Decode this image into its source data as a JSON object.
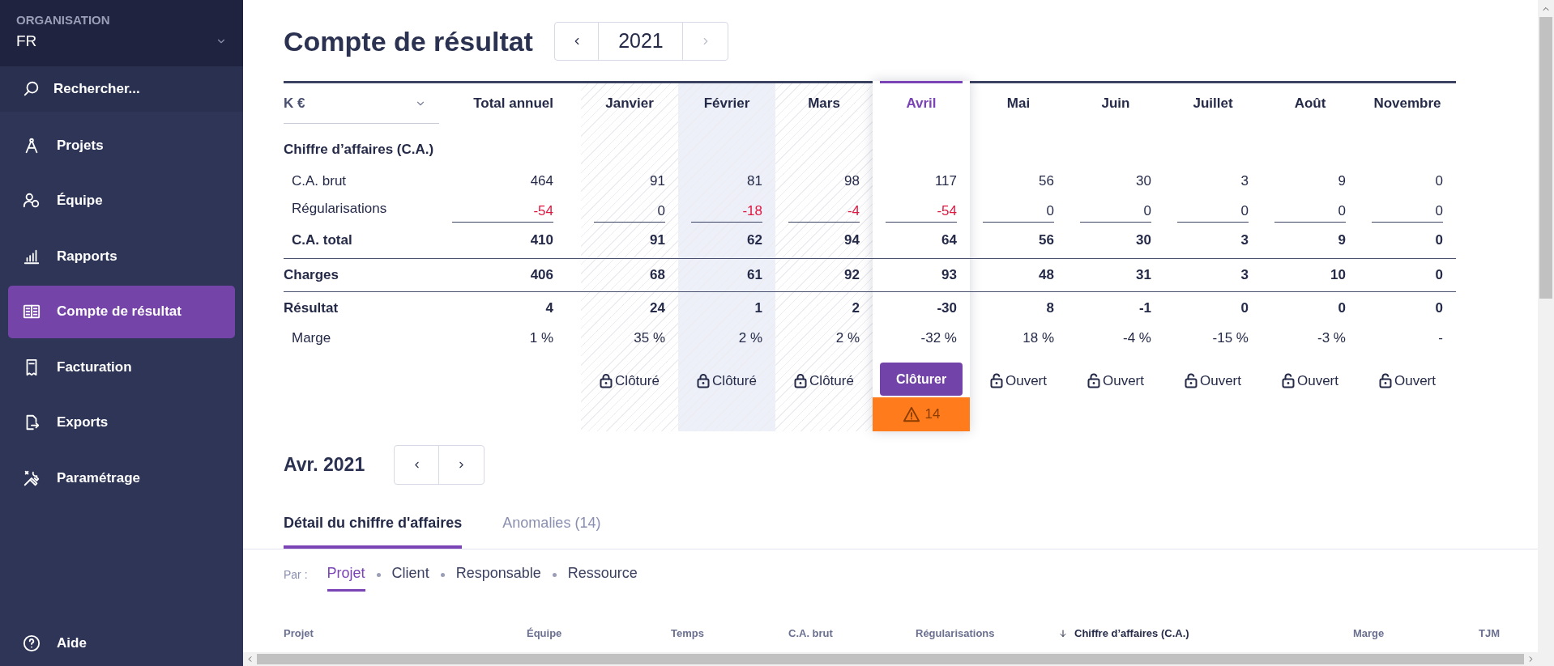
{
  "sidebar": {
    "organisation_label": "ORGANISATION",
    "organisation": "FR",
    "search": "Rechercher...",
    "items": [
      {
        "label": "Projets",
        "selected": false
      },
      {
        "label": "Équipe",
        "selected": false
      },
      {
        "label": "Rapports",
        "selected": false
      },
      {
        "label": "Compte de résultat",
        "selected": true
      },
      {
        "label": "Facturation",
        "selected": false
      },
      {
        "label": "Exports",
        "selected": false
      },
      {
        "label": "Paramétrage",
        "selected": false
      }
    ],
    "help": "Aide"
  },
  "header": {
    "title": "Compte de résultat",
    "year": "2021",
    "next_disabled": true
  },
  "table": {
    "unit": "K €",
    "total_label": "Total annuel",
    "months": [
      {
        "label": "Janvier",
        "kind": "closed",
        "status_label": "Clôturé",
        "highlighted": false
      },
      {
        "label": "Février",
        "kind": "closed",
        "status_label": "Clôturé",
        "highlighted": true
      },
      {
        "label": "Mars",
        "kind": "closed",
        "status_label": "Clôturé",
        "highlighted": false
      },
      {
        "label": "Avril",
        "kind": "current",
        "status_label": "Clôturer",
        "warning": "14",
        "highlighted": false
      },
      {
        "label": "Mai",
        "kind": "open",
        "status_label": "Ouvert",
        "highlighted": false
      },
      {
        "label": "Juin",
        "kind": "open",
        "status_label": "Ouvert",
        "highlighted": false
      },
      {
        "label": "Juillet",
        "kind": "open",
        "status_label": "Ouvert",
        "highlighted": false
      },
      {
        "label": "Août",
        "kind": "open",
        "status_label": "Ouvert",
        "highlighted": false
      },
      {
        "label": "Novembre",
        "kind": "open",
        "status_label": "Ouvert",
        "highlighted": false
      }
    ],
    "rows": [
      {
        "label": "Chiffre d’affaires (C.A.)",
        "kind": "section"
      },
      {
        "label": "C.A. brut",
        "kind": "item",
        "values": [
          "464",
          "91",
          "81",
          "98",
          "117",
          "56",
          "30",
          "3",
          "9",
          "0"
        ]
      },
      {
        "label": "Régularisations",
        "kind": "adjustment",
        "values": [
          {
            "value": "-54",
            "negative": true
          },
          {
            "value": "0",
            "negative": false
          },
          {
            "value": "-18",
            "negative": true
          },
          {
            "value": "-4",
            "negative": true
          },
          {
            "value": "-54",
            "negative": true
          },
          {
            "value": "0",
            "negative": false
          },
          {
            "value": "0",
            "negative": false
          },
          {
            "value": "0",
            "negative": false
          },
          {
            "value": "0",
            "negative": false
          },
          {
            "value": "0",
            "negative": false
          }
        ]
      },
      {
        "label": "C.A. total",
        "kind": "subtotal",
        "values": [
          "410",
          "91",
          "62",
          "94",
          "64",
          "56",
          "30",
          "3",
          "9",
          "0"
        ]
      },
      {
        "label": "Charges",
        "kind": "total",
        "values": [
          "406",
          "68",
          "61",
          "92",
          "93",
          "48",
          "31",
          "3",
          "10",
          "0"
        ]
      },
      {
        "label": "Résultat",
        "kind": "total",
        "values": [
          "4",
          "24",
          "1",
          "2",
          "-30",
          "8",
          "-1",
          "0",
          "0",
          "0"
        ]
      },
      {
        "label": "Marge",
        "kind": "item",
        "values": [
          "1 %",
          "35 %",
          "2 %",
          "2 %",
          "-32 %",
          "18 %",
          "-4 %",
          "-15 %",
          "-3 %",
          "-"
        ]
      }
    ]
  },
  "detail": {
    "period": "Avr. 2021",
    "tabs": [
      {
        "label": "Détail du chiffre d'affaires",
        "selected": true
      },
      {
        "label": "Anomalies (14)",
        "selected": false
      }
    ],
    "group_by": {
      "label": "Par :",
      "options": [
        {
          "label": "Projet",
          "selected": true
        },
        {
          "label": "Client",
          "selected": false
        },
        {
          "label": "Responsable",
          "selected": false
        },
        {
          "label": "Ressource",
          "selected": false
        }
      ]
    },
    "columns": [
      {
        "label": "Projet",
        "sorted": false
      },
      {
        "label": "Équipe",
        "sorted": false
      },
      {
        "label": "Temps",
        "sorted": false
      },
      {
        "label": "C.A. brut",
        "sorted": false
      },
      {
        "label": "Régularisations",
        "sorted": false
      },
      {
        "label": "Chiffre d’affaires (C.A.)",
        "sorted": true
      },
      {
        "label": "Marge",
        "sorted": false
      },
      {
        "label": "TJM",
        "sorted": false
      }
    ]
  }
}
